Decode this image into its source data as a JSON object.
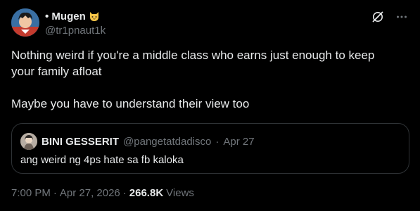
{
  "author": {
    "display_name": "• Mugen",
    "handle": "@tr1pnaut1k"
  },
  "tweet": {
    "paragraphs": [
      "Nothing weird if you're a middle class who earns just enough to keep\nyour family afloat",
      "Maybe you have to understand their view too"
    ]
  },
  "quote": {
    "display_name": "BINI GESSERIT",
    "handle": "@pangetatdadisco",
    "separator": "·",
    "date": "Apr 27",
    "text": "ang weird ng 4ps hate sa fb kaloka"
  },
  "meta": {
    "time": "7:00 PM",
    "sep1": "·",
    "date": "Apr 27, 2026",
    "sep2": "·",
    "views_count": "266.8K",
    "views_label": "Views"
  },
  "icons": {
    "grok": "grok-icon",
    "more": "more-icon",
    "emoji": "cat-emoji-icon"
  },
  "colors": {
    "background": "#000000",
    "primary_text": "#e7e9ea",
    "secondary_text": "#71767b",
    "border": "#2f3336"
  }
}
